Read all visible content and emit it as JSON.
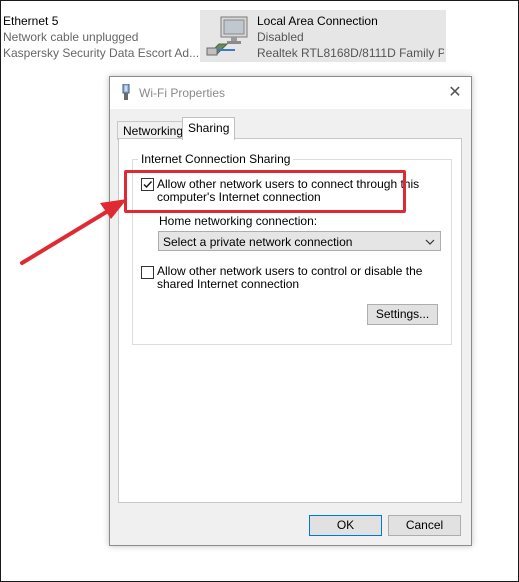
{
  "connections": [
    {
      "name": "Ethernet 5",
      "status": "Network cable unplugged",
      "device": "Kaspersky Security Data Escort Ad..."
    },
    {
      "name": "Local Area Connection",
      "status": "Disabled",
      "device": "Realtek RTL8168D/8111D Family P...",
      "icon": "network-adapter-icon"
    }
  ],
  "dialog": {
    "title": "Wi-Fi Properties",
    "tabs": [
      {
        "label": "Networking",
        "active": false
      },
      {
        "label": "Sharing",
        "active": true
      }
    ],
    "sharing": {
      "group_title": "Internet Connection Sharing",
      "allow_connect": {
        "label_line1": "Allow other network users to connect through this",
        "label_line2": "computer's Internet connection",
        "checked": true
      },
      "home_network_label": "Home networking connection:",
      "home_network_select": "Select a private network connection",
      "allow_control": {
        "label_line1": "Allow other network users to control or disable the",
        "label_line2": "shared Internet connection",
        "checked": false
      },
      "settings_button": "Settings..."
    },
    "ok_button": "OK",
    "cancel_button": "Cancel"
  },
  "annotation": {
    "highlight_color": "#e02a33",
    "arrow_color": "#e02a33"
  }
}
